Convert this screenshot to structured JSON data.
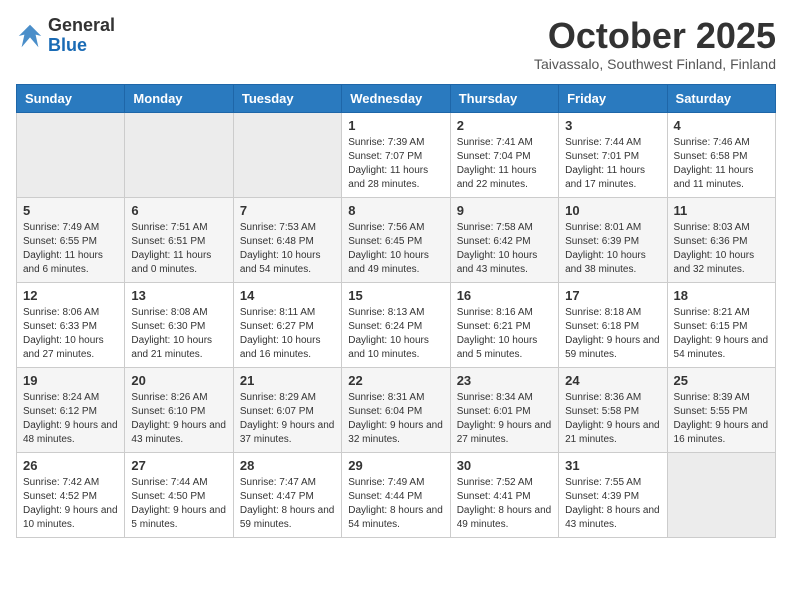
{
  "header": {
    "logo_general": "General",
    "logo_blue": "Blue",
    "month": "October 2025",
    "location": "Taivassalo, Southwest Finland, Finland"
  },
  "days_of_week": [
    "Sunday",
    "Monday",
    "Tuesday",
    "Wednesday",
    "Thursday",
    "Friday",
    "Saturday"
  ],
  "weeks": [
    [
      {
        "num": "",
        "data": ""
      },
      {
        "num": "",
        "data": ""
      },
      {
        "num": "",
        "data": ""
      },
      {
        "num": "1",
        "data": "Sunrise: 7:39 AM\nSunset: 7:07 PM\nDaylight: 11 hours and 28 minutes."
      },
      {
        "num": "2",
        "data": "Sunrise: 7:41 AM\nSunset: 7:04 PM\nDaylight: 11 hours and 22 minutes."
      },
      {
        "num": "3",
        "data": "Sunrise: 7:44 AM\nSunset: 7:01 PM\nDaylight: 11 hours and 17 minutes."
      },
      {
        "num": "4",
        "data": "Sunrise: 7:46 AM\nSunset: 6:58 PM\nDaylight: 11 hours and 11 minutes."
      }
    ],
    [
      {
        "num": "5",
        "data": "Sunrise: 7:49 AM\nSunset: 6:55 PM\nDaylight: 11 hours and 6 minutes."
      },
      {
        "num": "6",
        "data": "Sunrise: 7:51 AM\nSunset: 6:51 PM\nDaylight: 11 hours and 0 minutes."
      },
      {
        "num": "7",
        "data": "Sunrise: 7:53 AM\nSunset: 6:48 PM\nDaylight: 10 hours and 54 minutes."
      },
      {
        "num": "8",
        "data": "Sunrise: 7:56 AM\nSunset: 6:45 PM\nDaylight: 10 hours and 49 minutes."
      },
      {
        "num": "9",
        "data": "Sunrise: 7:58 AM\nSunset: 6:42 PM\nDaylight: 10 hours and 43 minutes."
      },
      {
        "num": "10",
        "data": "Sunrise: 8:01 AM\nSunset: 6:39 PM\nDaylight: 10 hours and 38 minutes."
      },
      {
        "num": "11",
        "data": "Sunrise: 8:03 AM\nSunset: 6:36 PM\nDaylight: 10 hours and 32 minutes."
      }
    ],
    [
      {
        "num": "12",
        "data": "Sunrise: 8:06 AM\nSunset: 6:33 PM\nDaylight: 10 hours and 27 minutes."
      },
      {
        "num": "13",
        "data": "Sunrise: 8:08 AM\nSunset: 6:30 PM\nDaylight: 10 hours and 21 minutes."
      },
      {
        "num": "14",
        "data": "Sunrise: 8:11 AM\nSunset: 6:27 PM\nDaylight: 10 hours and 16 minutes."
      },
      {
        "num": "15",
        "data": "Sunrise: 8:13 AM\nSunset: 6:24 PM\nDaylight: 10 hours and 10 minutes."
      },
      {
        "num": "16",
        "data": "Sunrise: 8:16 AM\nSunset: 6:21 PM\nDaylight: 10 hours and 5 minutes."
      },
      {
        "num": "17",
        "data": "Sunrise: 8:18 AM\nSunset: 6:18 PM\nDaylight: 9 hours and 59 minutes."
      },
      {
        "num": "18",
        "data": "Sunrise: 8:21 AM\nSunset: 6:15 PM\nDaylight: 9 hours and 54 minutes."
      }
    ],
    [
      {
        "num": "19",
        "data": "Sunrise: 8:24 AM\nSunset: 6:12 PM\nDaylight: 9 hours and 48 minutes."
      },
      {
        "num": "20",
        "data": "Sunrise: 8:26 AM\nSunset: 6:10 PM\nDaylight: 9 hours and 43 minutes."
      },
      {
        "num": "21",
        "data": "Sunrise: 8:29 AM\nSunset: 6:07 PM\nDaylight: 9 hours and 37 minutes."
      },
      {
        "num": "22",
        "data": "Sunrise: 8:31 AM\nSunset: 6:04 PM\nDaylight: 9 hours and 32 minutes."
      },
      {
        "num": "23",
        "data": "Sunrise: 8:34 AM\nSunset: 6:01 PM\nDaylight: 9 hours and 27 minutes."
      },
      {
        "num": "24",
        "data": "Sunrise: 8:36 AM\nSunset: 5:58 PM\nDaylight: 9 hours and 21 minutes."
      },
      {
        "num": "25",
        "data": "Sunrise: 8:39 AM\nSunset: 5:55 PM\nDaylight: 9 hours and 16 minutes."
      }
    ],
    [
      {
        "num": "26",
        "data": "Sunrise: 7:42 AM\nSunset: 4:52 PM\nDaylight: 9 hours and 10 minutes."
      },
      {
        "num": "27",
        "data": "Sunrise: 7:44 AM\nSunset: 4:50 PM\nDaylight: 9 hours and 5 minutes."
      },
      {
        "num": "28",
        "data": "Sunrise: 7:47 AM\nSunset: 4:47 PM\nDaylight: 8 hours and 59 minutes."
      },
      {
        "num": "29",
        "data": "Sunrise: 7:49 AM\nSunset: 4:44 PM\nDaylight: 8 hours and 54 minutes."
      },
      {
        "num": "30",
        "data": "Sunrise: 7:52 AM\nSunset: 4:41 PM\nDaylight: 8 hours and 49 minutes."
      },
      {
        "num": "31",
        "data": "Sunrise: 7:55 AM\nSunset: 4:39 PM\nDaylight: 8 hours and 43 minutes."
      },
      {
        "num": "",
        "data": ""
      }
    ]
  ]
}
